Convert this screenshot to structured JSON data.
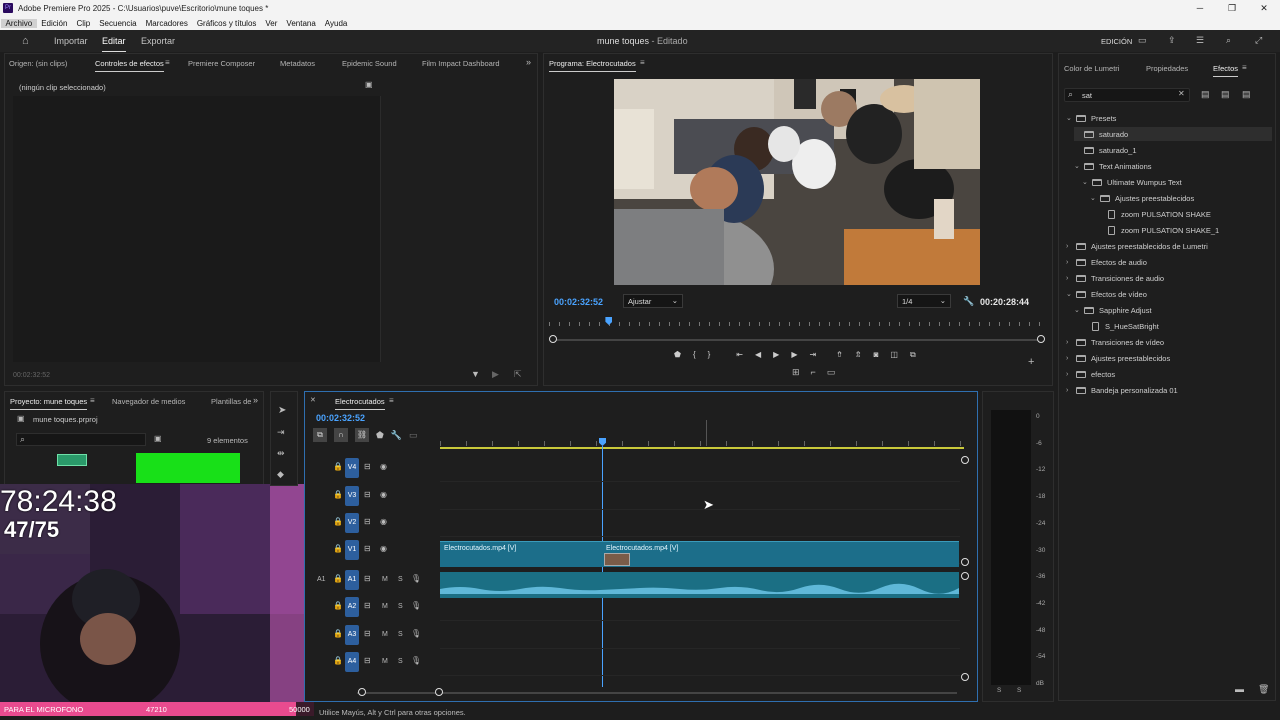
{
  "window": {
    "title": "Adobe Premiere Pro 2025 - C:\\Usuarios\\puve\\Escritorio\\mune toques *",
    "controls": [
      "─",
      "❐",
      "✕"
    ]
  },
  "menu": [
    "Archivo",
    "Edición",
    "Clip",
    "Secuencia",
    "Marcadores",
    "Gráficos y títulos",
    "Ver",
    "Ventana",
    "Ayuda"
  ],
  "header": {
    "import": "Importar",
    "edit": "Editar",
    "export": "Exportar",
    "project_title": "mune toques",
    "project_state": " - Editado",
    "workspace": "EDICIÓN"
  },
  "source_panel": {
    "tabs": [
      "Origen: (sin clips)",
      "Controles de efectos",
      "Premiere Composer",
      "Metadatos",
      "Epidemic Sound",
      "Film Impact Dashboard"
    ],
    "no_clip": "(ningún clip seleccionado)",
    "timecode": "00:02:32:52"
  },
  "program": {
    "tab": "Programa: Electrocutados",
    "timecode": "00:02:32:52",
    "fit": "Ajustar",
    "quality": "1/4",
    "duration": "00:20:28:44",
    "playhead_fraction": 0.12
  },
  "project_panel": {
    "tabs": [
      "Proyecto: mune toques",
      "Navegador de medios",
      "Plantillas de"
    ],
    "file": "mune toques.prproj",
    "count": "9 elementos"
  },
  "overlay": {
    "timer": "78:24:38",
    "ratio": "47/75",
    "bar_label": "PARA EL MICROFONO",
    "bar_value": "47210",
    "bar_goal": "50000",
    "bar_fraction": 0.944
  },
  "timeline": {
    "tab": "Electrocutados",
    "timecode": "00:02:32:52",
    "video_tracks": [
      "V4",
      "V3",
      "V2",
      "V1"
    ],
    "audio_tracks": [
      "A1",
      "A2",
      "A3",
      "A4"
    ],
    "source_patch": "A1",
    "clips": [
      {
        "label": "Electrocutados.mp4 [V]"
      },
      {
        "label": "Electrocutados.mp4 [V]"
      }
    ],
    "track_letters": {
      "m": "M",
      "s": "S"
    }
  },
  "meters": {
    "labels": [
      "0",
      "-6",
      "-12",
      "-18",
      "-24",
      "-30",
      "-36",
      "-42",
      "-48",
      "-54",
      "dB"
    ],
    "solo": [
      "S",
      "S"
    ]
  },
  "status": "Utilice Mayús, Alt y Ctrl para otras opciones.",
  "effects_panel": {
    "tabs": [
      "Color de Lumetri",
      "Propiedades",
      "Efectos"
    ],
    "search": "sat",
    "tree": [
      "Presets",
      "saturado",
      "saturado_1",
      "Text Animations",
      "Ultimate Wumpus Text",
      "Ajustes preestablecidos",
      "zoom PULSATION SHAKE",
      "zoom PULSATION SHAKE_1",
      "Ajustes preestablecidos de Lumetri",
      "Efectos de audio",
      "Transiciones de audio",
      "Efectos de vídeo",
      "Sapphire Adjust",
      "S_HueSatBright",
      "Transiciones de vídeo",
      "Ajustes preestablecidos",
      "efectos",
      "Bandeja personalizada 01"
    ]
  },
  "colors": {
    "accent": "#4aa3ff",
    "clip": "#1c6e8a",
    "green": "#18e018",
    "pink": "#e94b8f"
  }
}
